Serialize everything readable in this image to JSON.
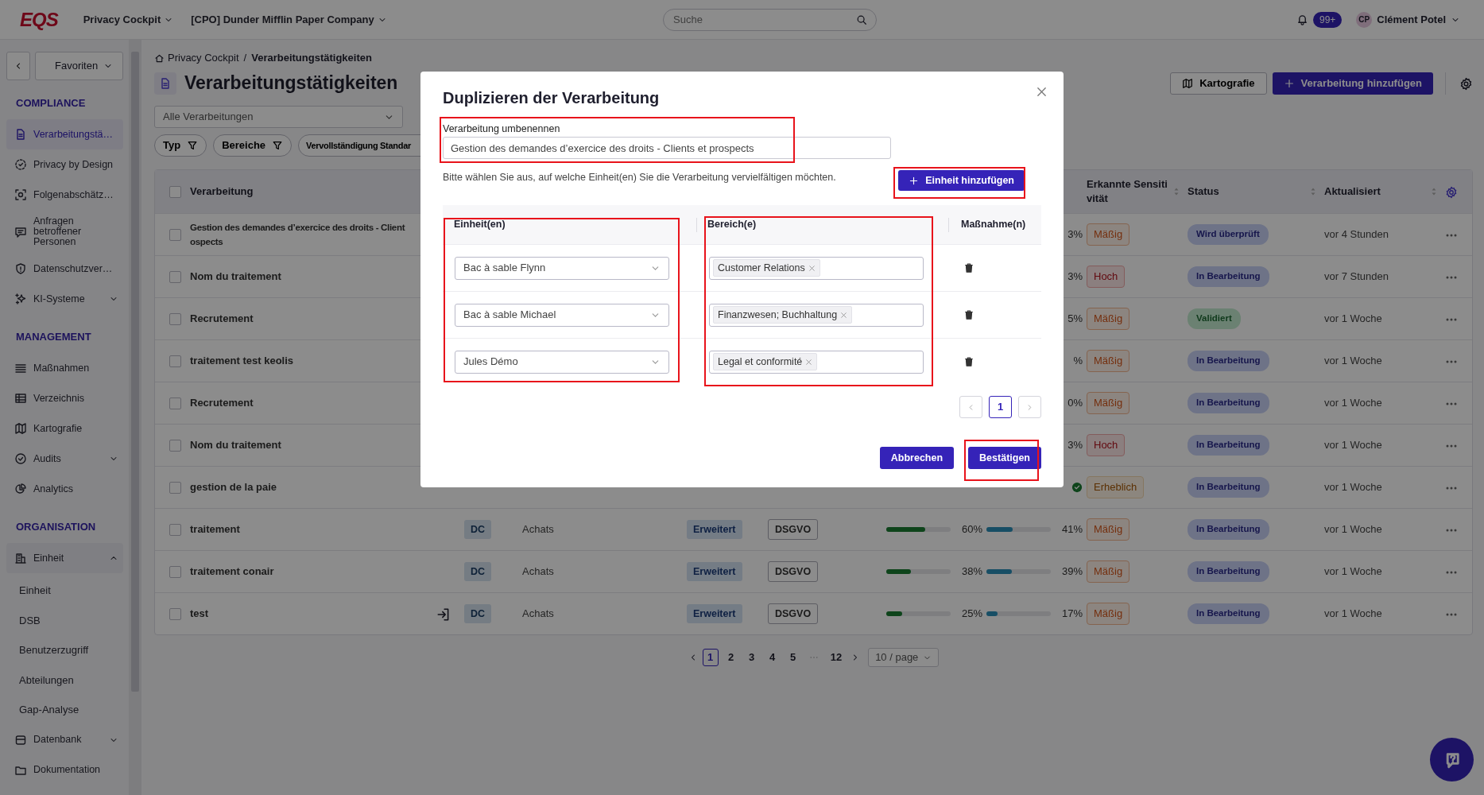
{
  "topbar": {
    "logo": "EQS",
    "app_menu": "Privacy Cockpit",
    "org_menu": "[CPO] Dunder Mifflin Paper Company",
    "search": {
      "placeholder": "Suche"
    },
    "notifications": "99+",
    "user": {
      "initials": "CP",
      "name": "Clément Potel"
    }
  },
  "sidebar": {
    "favorites": "Favoriten",
    "sections": [
      {
        "title": "COMPLIANCE",
        "items": [
          {
            "kind": "link",
            "label": "Verarbeitungstä…",
            "selected": true
          },
          {
            "kind": "link",
            "label": "Privacy by Design",
            "selected": false
          },
          {
            "kind": "link",
            "label": "Folgenabschätz…",
            "selected": false
          },
          {
            "kind": "link",
            "label": "Anfragen betroffener Personen",
            "selected": false
          },
          {
            "kind": "link",
            "label": "Datenschutzver…",
            "selected": false
          },
          {
            "kind": "group",
            "label": "KI-Systeme",
            "selected": false,
            "expanded": false
          }
        ]
      },
      {
        "title": "MANAGEMENT",
        "items": [
          {
            "kind": "link",
            "label": "Maßnahmen",
            "selected": false
          },
          {
            "kind": "link",
            "label": "Verzeichnis",
            "selected": false
          },
          {
            "kind": "link",
            "label": "Kartografie",
            "selected": false
          },
          {
            "kind": "group",
            "label": "Audits",
            "selected": false,
            "expanded": false
          },
          {
            "kind": "link",
            "label": "Analytics",
            "selected": false
          }
        ]
      },
      {
        "title": "ORGANISATION",
        "items": [
          {
            "kind": "group",
            "label": "Einheit",
            "selected": false,
            "expanded": true,
            "children": [
              {
                "label": "Einheit",
                "selected": false
              },
              {
                "label": "DSB",
                "selected": false
              },
              {
                "label": "Benutzerzugriff",
                "selected": false
              },
              {
                "label": "Abteilungen",
                "selected": false
              },
              {
                "label": "Gap-Analyse",
                "selected": false
              }
            ]
          },
          {
            "kind": "group",
            "label": "Datenbank",
            "selected": false,
            "expanded": false
          },
          {
            "kind": "link",
            "label": "Dokumentation",
            "selected": false
          }
        ]
      }
    ]
  },
  "breadcrumb": {
    "separator": "/",
    "items": [
      {
        "label": "Privacy Cockpit"
      },
      {
        "label": "Verarbeitungstätigkeiten"
      }
    ]
  },
  "title": "Verarbeitungstätigkeiten",
  "actions": [
    {
      "kind": "outline",
      "label": "Kartografie"
    },
    {
      "kind": "primary",
      "label": "Verarbeitung hinzufügen"
    }
  ],
  "filter": {
    "value": "Alle Verarbeitungen"
  },
  "chips": [
    "Typ",
    "Bereiche",
    "Vervollständigung Standar"
  ],
  "table": {
    "header_checkbox": {
      "checked": false
    },
    "columns": [
      {
        "kind": "name",
        "label": "Verarbeitung"
      },
      {
        "kind": "sensitivity",
        "label": "Erkannte Sensitivität",
        "sortable": true
      },
      {
        "kind": "status",
        "label": "Status",
        "sortable": true
      },
      {
        "kind": "updated",
        "label": "Aktualisiert",
        "sortable": true
      }
    ],
    "rows": [
      {
        "selected": false,
        "name": [
          "Gestion des demandes d’exercice des droits - Client",
          "ospects"
        ],
        "progress_2": {
          "reading": "3%"
        },
        "sensitivity": {
          "kind": "moderate",
          "label": "Mäßig"
        },
        "status": {
          "kind": "review",
          "label": "Wird überprüft"
        },
        "updated": "vor 4 Stunden"
      },
      {
        "selected": false,
        "name": [
          "Nom du traitement"
        ],
        "progress_2": {
          "reading": "3%"
        },
        "sensitivity": {
          "kind": "high",
          "label": "Hoch"
        },
        "status": {
          "kind": "progress",
          "label": "In Bearbeitung"
        },
        "updated": "vor 7 Stunden"
      },
      {
        "selected": false,
        "name": [
          "Recrutement"
        ],
        "progress_2": {
          "reading": "5%"
        },
        "sensitivity": {
          "kind": "moderate",
          "label": "Mäßig"
        },
        "status": {
          "kind": "validated",
          "label": "Validiert"
        },
        "updated": "vor 1 Woche"
      },
      {
        "selected": false,
        "name": [
          "traitement test keolis"
        ],
        "progress_2": {
          "reading": "%"
        },
        "sensitivity": {
          "kind": "moderate",
          "label": "Mäßig"
        },
        "status": {
          "kind": "progress",
          "label": "In Bearbeitung"
        },
        "updated": "vor 1 Woche"
      },
      {
        "selected": false,
        "name": [
          "Recrutement"
        ],
        "progress_2": {
          "reading": "0%"
        },
        "sensitivity": {
          "kind": "moderate",
          "label": "Mäßig"
        },
        "status": {
          "kind": "progress",
          "label": "In Bearbeitung"
        },
        "updated": "vor 1 Woche"
      },
      {
        "selected": false,
        "name": [
          "Nom du traitement"
        ],
        "progress_2": {
          "reading": "3%"
        },
        "sensitivity": {
          "kind": "high",
          "label": "Hoch"
        },
        "status": {
          "kind": "progress",
          "label": "In Bearbeitung"
        },
        "updated": "vor 1 Woche"
      },
      {
        "selected": false,
        "name": [
          "gestion de la paie"
        ],
        "progress_2": {
          "done": true
        },
        "sensitivity": {
          "kind": "considerable",
          "label": "Erheblich"
        },
        "status": {
          "kind": "progress",
          "label": "In Bearbeitung"
        },
        "updated": "vor 1 Woche"
      },
      {
        "selected": false,
        "name": [
          "traitement"
        ],
        "linked": false,
        "type": "DC",
        "area": "Achats",
        "level_tag": "Erweitert",
        "framework": "DSGVO",
        "progress_1": {
          "level": 0.6,
          "reading": "60%"
        },
        "progress_2": {
          "level": 0.41,
          "reading": "41%"
        },
        "sensitivity": {
          "kind": "moderate",
          "label": "Mäßig"
        },
        "status": {
          "kind": "progress",
          "label": "In Bearbeitung"
        },
        "updated": "vor 1 Woche"
      },
      {
        "selected": false,
        "name": [
          "traitement conair"
        ],
        "linked": false,
        "type": "DC",
        "area": "Achats",
        "level_tag": "Erweitert",
        "framework": "DSGVO",
        "progress_1": {
          "level": 0.38,
          "reading": "38%"
        },
        "progress_2": {
          "level": 0.39,
          "reading": "39%"
        },
        "sensitivity": {
          "kind": "moderate",
          "label": "Mäßig"
        },
        "status": {
          "kind": "progress",
          "label": "In Bearbeitung"
        },
        "updated": "vor 1 Woche"
      },
      {
        "selected": false,
        "name": [
          "test"
        ],
        "linked": true,
        "type": "DC",
        "area": "Achats",
        "level_tag": "Erweitert",
        "framework": "DSGVO",
        "progress_1": {
          "level": 0.25,
          "reading": "25%"
        },
        "progress_2": {
          "level": 0.17,
          "reading": "17%"
        },
        "sensitivity": {
          "kind": "moderate",
          "label": "Mäßig"
        },
        "status": {
          "kind": "progress",
          "label": "In Bearbeitung"
        },
        "updated": "vor 1 Woche"
      }
    ]
  },
  "pagination": {
    "pages": [
      {
        "kind": "page",
        "label": "1",
        "selected": true
      },
      {
        "kind": "page",
        "label": "2",
        "selected": false
      },
      {
        "kind": "page",
        "label": "3",
        "selected": false
      },
      {
        "kind": "page",
        "label": "4",
        "selected": false
      },
      {
        "kind": "page",
        "label": "5",
        "selected": false
      },
      {
        "kind": "ellipsis"
      },
      {
        "kind": "page",
        "label": "12",
        "selected": false
      }
    ],
    "page_size": "10 / page"
  },
  "dialog": {
    "title": "Duplizieren der Verarbeitung",
    "rename": {
      "label": "Verarbeitung umbenennen",
      "value": "Gestion des demandes d’exercice des droits - Clients et prospects",
      "highlighted": true
    },
    "hint": "Bitte wählen Sie aus, auf welche Einheit(en) Sie die Verarbeitung vervielfältigen möchten.",
    "add_button": {
      "label": "Einheit hinzufügen",
      "highlighted": true
    },
    "columns": [
      {
        "kind": "unit",
        "label": "Einheit(en)",
        "highlighted": true
      },
      {
        "kind": "areas",
        "label": "Bereich(e)",
        "highlighted": true
      },
      {
        "kind": "measures",
        "label": "Maßnahme(n)",
        "highlighted": false
      }
    ],
    "rows": [
      {
        "unit": "Bac à sable Flynn",
        "areas": [
          "Customer Relations"
        ]
      },
      {
        "unit": "Bac à sable Michael",
        "areas": [
          "Finanzwesen; Buchhaltung"
        ]
      },
      {
        "unit": "Jules Démo",
        "areas": [
          "Legal et conformité"
        ]
      }
    ],
    "pagination": {
      "pages": [
        {
          "label": "1",
          "selected": true
        }
      ]
    },
    "buttons": [
      {
        "label": "Abbrechen",
        "highlighted": false
      },
      {
        "label": "Bestätigen",
        "highlighted": true
      }
    ]
  }
}
